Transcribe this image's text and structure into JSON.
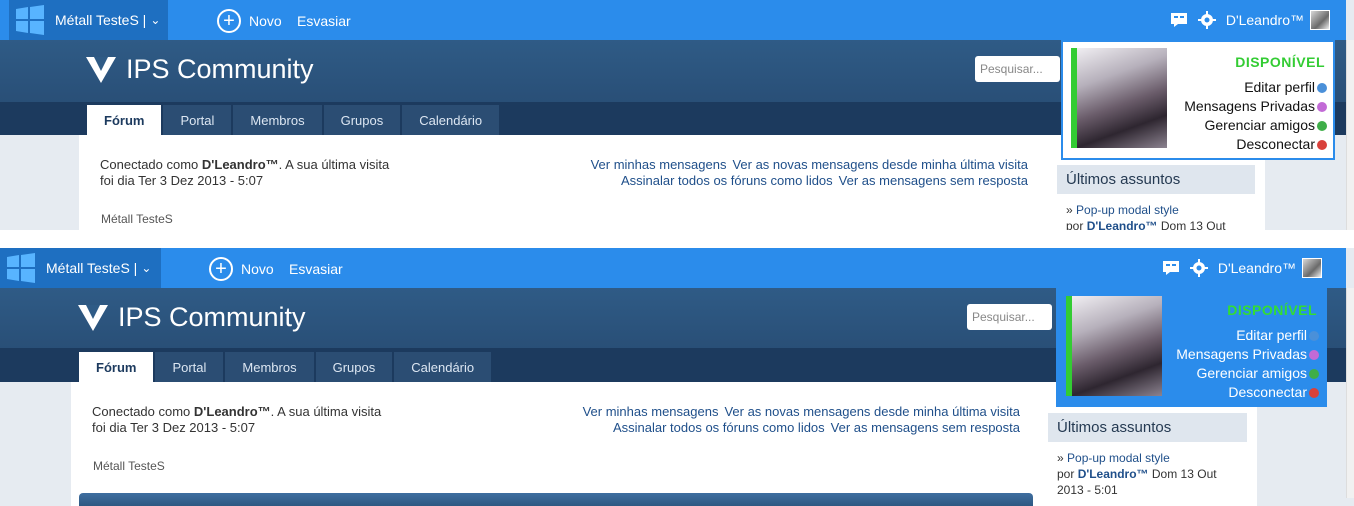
{
  "toolbar": {
    "site_name": "Métall TesteS |",
    "new_label": "Novo",
    "clear_label": "Esvasiar",
    "username": "D'Leandro™"
  },
  "header": {
    "brand": "IPS Community",
    "search_placeholder": "Pesquisar..."
  },
  "nav": {
    "tabs": [
      "Fórum",
      "Portal",
      "Membros",
      "Grupos",
      "Calendário"
    ]
  },
  "welcome": {
    "prefix": "Conectado como ",
    "user": "D'Leandro™",
    "suffix": ". A sua última visita foi dia Ter 3 Dez 2013 - 5:07"
  },
  "links": {
    "line1": [
      "Ver minhas mensagens",
      "Ver as novas mensagens desde minha última visita"
    ],
    "line2": [
      "Assinalar todos os fóruns como lidos",
      "Ver as mensagens sem resposta"
    ]
  },
  "breadcrumb": "Métall TesteS",
  "topics": {
    "title": "Últimos assuntos",
    "item_title": "Pop-up modal style",
    "by": "por ",
    "author": "D'Leandro™",
    "date": " Dom 13 Out 2013 - 5:01"
  },
  "popup": {
    "status": "DISPONÍVEL",
    "items": [
      {
        "label": "Editar perfil",
        "icon": "user-icon",
        "color": "#4a90d9"
      },
      {
        "label": "Mensagens Privadas",
        "icon": "mail-user-icon",
        "color": "#c26ad6"
      },
      {
        "label": "Gerenciar amigos",
        "icon": "friends-icon",
        "color": "#3fae49"
      },
      {
        "label": "Desconectar",
        "icon": "logout-user-icon",
        "color": "#d9413b"
      }
    ]
  },
  "colors": {
    "toolbar": "#2b8ceb",
    "header": "#2f5b86",
    "nav": "#1c3a5e",
    "status_green": "#33cc33"
  }
}
